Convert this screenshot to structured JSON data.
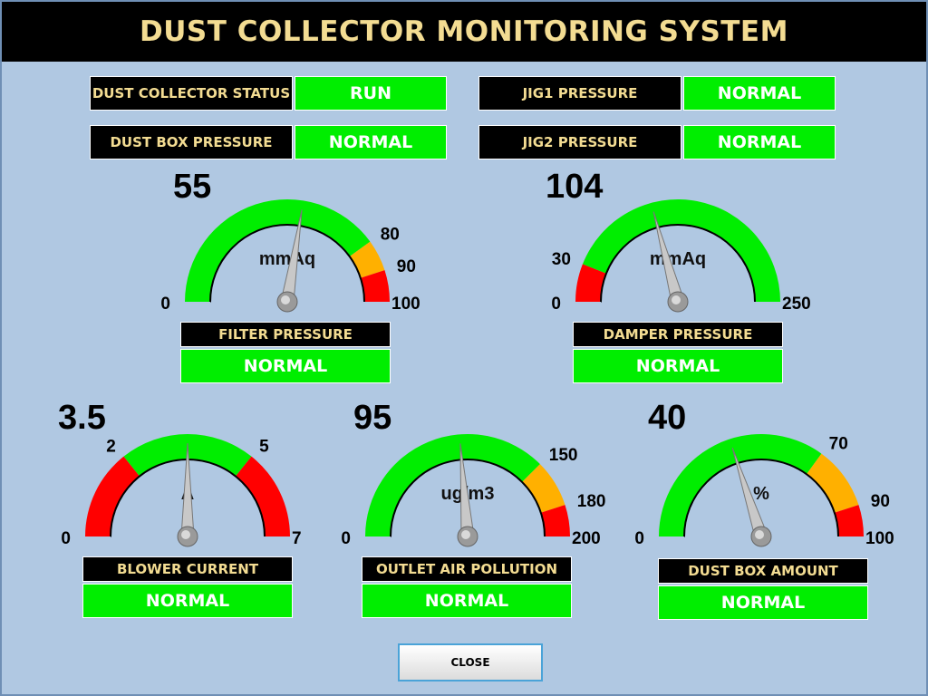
{
  "window": {
    "title": "DUST COLLECTOR MONITORING SYSTEM"
  },
  "colors": {
    "ok": "#00ee00",
    "warn": "#ffb000",
    "alarm": "#ff0000",
    "label_text": "#f3dc92"
  },
  "status_panel": {
    "dust_collector_status": {
      "label": "DUST COLLECTOR STATUS",
      "value": "RUN"
    },
    "dust_box_pressure": {
      "label": "DUST BOX PRESSURE",
      "value": "NORMAL"
    },
    "jig1_pressure": {
      "label": "JIG1 PRESSURE",
      "value": "NORMAL"
    },
    "jig2_pressure": {
      "label": "JIG2 PRESSURE",
      "value": "NORMAL"
    }
  },
  "gauges": {
    "filter_pressure": {
      "name": "FILTER PRESSURE",
      "status": "NORMAL",
      "value_text": "55",
      "value": 55,
      "unit": "mmAq",
      "min": 0,
      "max": 100,
      "zones": [
        {
          "from": 0,
          "to": 80,
          "color": "green"
        },
        {
          "from": 80,
          "to": 90,
          "color": "orange"
        },
        {
          "from": 90,
          "to": 100,
          "color": "red"
        }
      ],
      "ticks": [
        {
          "v": 0,
          "label": "0"
        },
        {
          "v": 80,
          "label": "80"
        },
        {
          "v": 90,
          "label": "90"
        },
        {
          "v": 100,
          "label": "100"
        }
      ]
    },
    "damper_pressure": {
      "name": "DAMPER  PRESSURE",
      "status": "NORMAL",
      "value_text": "104",
      "value": 104,
      "unit": "mmAq",
      "min": 0,
      "max": 250,
      "zones": [
        {
          "from": 0,
          "to": 30,
          "color": "red"
        },
        {
          "from": 30,
          "to": 250,
          "color": "green"
        }
      ],
      "ticks": [
        {
          "v": 0,
          "label": "0"
        },
        {
          "v": 30,
          "label": "30"
        },
        {
          "v": 250,
          "label": "250"
        }
      ]
    },
    "blower_current": {
      "name": "BLOWER CURRENT",
      "status": "NORMAL",
      "value_text": "3.5",
      "value": 3.5,
      "unit": "A",
      "min": 0,
      "max": 7,
      "zones": [
        {
          "from": 0,
          "to": 2,
          "color": "red"
        },
        {
          "from": 2,
          "to": 5,
          "color": "green"
        },
        {
          "from": 5,
          "to": 7,
          "color": "red"
        }
      ],
      "ticks": [
        {
          "v": 0,
          "label": "0"
        },
        {
          "v": 2,
          "label": "2"
        },
        {
          "v": 5,
          "label": "5"
        },
        {
          "v": 7,
          "label": "7"
        }
      ]
    },
    "outlet_air_pollution": {
      "name": "OUTLET AIR POLLUTION",
      "status": "NORMAL",
      "value_text": "95",
      "value": 95,
      "unit": "ug/m3",
      "min": 0,
      "max": 200,
      "zones": [
        {
          "from": 0,
          "to": 150,
          "color": "green"
        },
        {
          "from": 150,
          "to": 180,
          "color": "orange"
        },
        {
          "from": 180,
          "to": 200,
          "color": "red"
        }
      ],
      "ticks": [
        {
          "v": 0,
          "label": "0"
        },
        {
          "v": 150,
          "label": "150"
        },
        {
          "v": 180,
          "label": "180"
        },
        {
          "v": 200,
          "label": "200"
        }
      ]
    },
    "dust_box_amount": {
      "name": "DUST BOX AMOUNT",
      "status": "NORMAL",
      "value_text": "40",
      "value": 40,
      "unit": "%",
      "min": 0,
      "max": 100,
      "zones": [
        {
          "from": 0,
          "to": 70,
          "color": "green"
        },
        {
          "from": 70,
          "to": 90,
          "color": "orange"
        },
        {
          "from": 90,
          "to": 100,
          "color": "red"
        }
      ],
      "ticks": [
        {
          "v": 0,
          "label": "0"
        },
        {
          "v": 70,
          "label": "70"
        },
        {
          "v": 90,
          "label": "90"
        },
        {
          "v": 100,
          "label": "100"
        }
      ]
    }
  },
  "footer": {
    "close_label": "CLOSE"
  }
}
